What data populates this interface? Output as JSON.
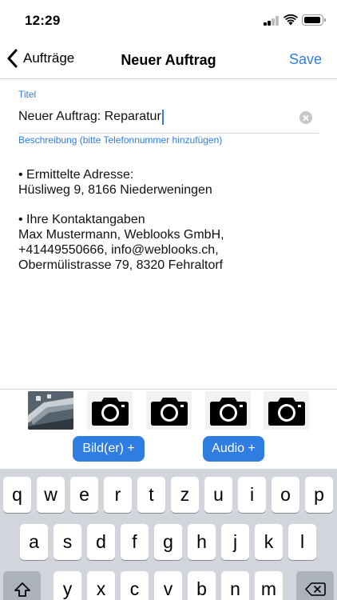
{
  "status_bar": {
    "time": "12:29",
    "signal_bars": 2,
    "signal_bars_total": 4
  },
  "nav": {
    "back_label": "Aufträge",
    "title": "Neuer Auftrag",
    "save_label": "Save"
  },
  "form": {
    "title_label": "Titel",
    "title_value": "Neuer Auftrag: Reparatur",
    "description_label": "Beschreibung (bitte Telefonnummer hinzufügen)",
    "description_lines": [
      "• Ermittelte Adresse:",
      "Hüsliweg 9, 8166 Niederweningen",
      "",
      "• Ihre Kontaktangaben",
      "Max Mustermann, Weblooks GmbH,",
      "+41449550666, info@weblooks.ch,",
      "Obermülistrasse 79, 8320 Fehraltorf"
    ]
  },
  "attachments": {
    "items": [
      "photo-thumbnail",
      "camera-icon",
      "camera-icon",
      "camera-icon",
      "camera-icon"
    ],
    "add_images_label": "Bild(er) +",
    "add_audio_label": "Audio +"
  },
  "keyboard": {
    "row1": [
      "q",
      "w",
      "e",
      "r",
      "t",
      "z",
      "u",
      "i",
      "o",
      "p"
    ],
    "row2": [
      "a",
      "s",
      "d",
      "f",
      "g",
      "h",
      "j",
      "k",
      "l"
    ],
    "row3": [
      "y",
      "x",
      "c",
      "v",
      "b",
      "n",
      "m"
    ],
    "shift_icon": "shift-icon",
    "delete_icon": "backspace-icon"
  },
  "colors": {
    "accent": "#2f7de1",
    "keyboard_bg": "#d2d5db",
    "key_fn": "#adb3bc"
  }
}
